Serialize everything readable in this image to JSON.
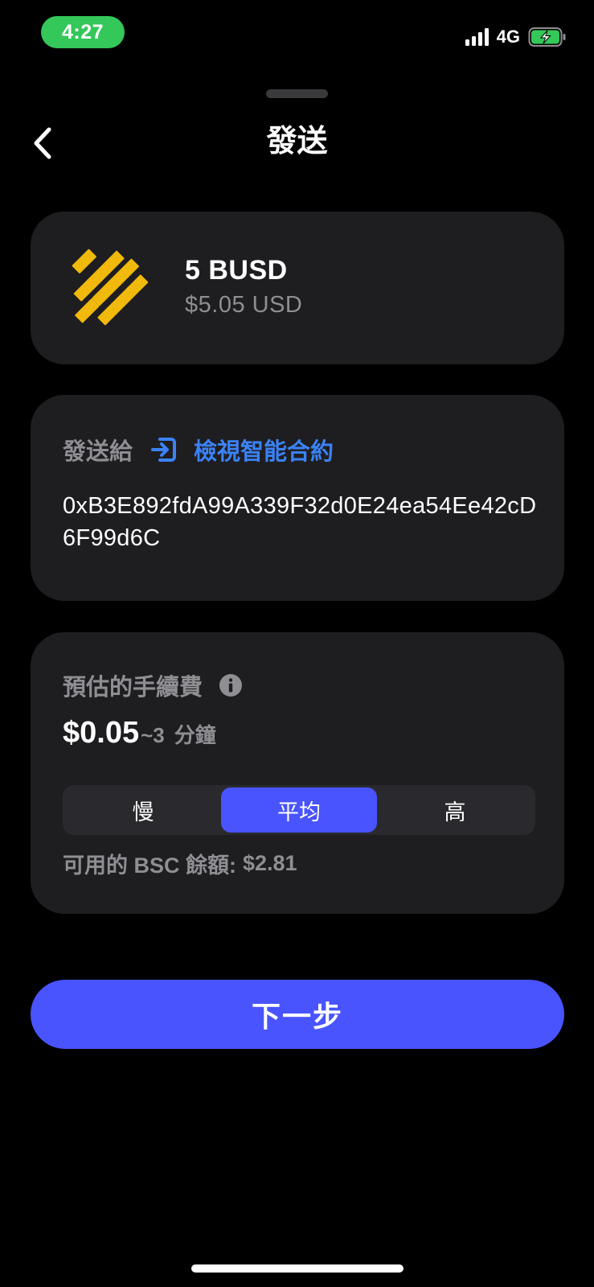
{
  "status_bar": {
    "time": "4:27",
    "network": "4G",
    "icons": [
      "signal-icon",
      "battery-charging-icon"
    ]
  },
  "header": {
    "title": "發送",
    "back_icon": "chevron-left-icon"
  },
  "token": {
    "icon": "busd-logo",
    "amount": "5 BUSD",
    "fiat_value": "$5.05 USD",
    "brand_color": "#F0B90B"
  },
  "recipient": {
    "label": "發送給",
    "contract_icon": "enter-arrow-icon",
    "contract_link": "檢視智能合約",
    "address": "0xB3E892fdA99A339F32d0E24ea54Ee42cD6F99d6C"
  },
  "fee": {
    "label": "預估的手續費",
    "info_icon": "info-icon",
    "amount": "$0.05",
    "time": "~3",
    "time_unit": "分鐘",
    "speed_options": [
      {
        "label": "慢",
        "selected": false
      },
      {
        "label": "平均",
        "selected": true
      },
      {
        "label": "高",
        "selected": false
      }
    ],
    "balance_label": "可用的 BSC 餘額:",
    "balance_value": "$2.81"
  },
  "next_button": {
    "label": "下一步"
  },
  "colors": {
    "background": "#000000",
    "card": "#1E1E21",
    "accent": "#4954FF",
    "link": "#3B82F6",
    "muted_text": "#8E8E93",
    "status_pill": "#34C759"
  }
}
